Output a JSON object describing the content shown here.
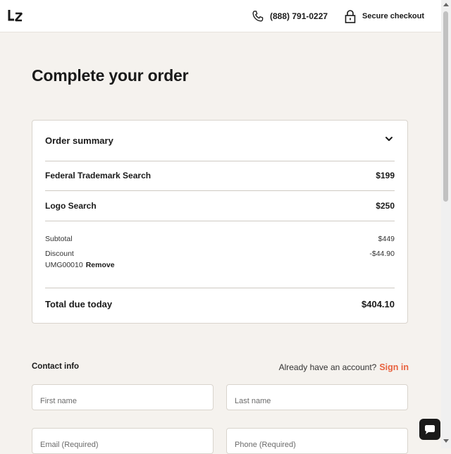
{
  "header": {
    "phone": "(888) 791-0227",
    "secure_label": "Secure checkout"
  },
  "page": {
    "title": "Complete your order"
  },
  "order_summary": {
    "title": "Order summary",
    "items": [
      {
        "name": "Federal Trademark Search",
        "price": "$199"
      },
      {
        "name": "Logo Search",
        "price": "$250"
      }
    ],
    "subtotal_label": "Subtotal",
    "subtotal_value": "$449",
    "discount_label": "Discount",
    "discount_value": "-$44.90",
    "discount_code": "UMG00010",
    "remove_label": "Remove",
    "total_label": "Total due today",
    "total_value": "$404.10"
  },
  "contact": {
    "title": "Contact info",
    "account_prompt": "Already have an account?",
    "sign_in_label": "Sign in",
    "first_name_placeholder": "First name",
    "last_name_placeholder": "Last name",
    "email_placeholder": "Email (Required)",
    "phone_placeholder": "Phone (Required)"
  },
  "colors": {
    "background": "#f5f2ee",
    "accent": "#e8623f",
    "text": "#1a1a1a"
  },
  "icons": [
    "lz-logo",
    "phone-icon",
    "lock-icon",
    "chevron-down-icon",
    "chat-icon"
  ]
}
